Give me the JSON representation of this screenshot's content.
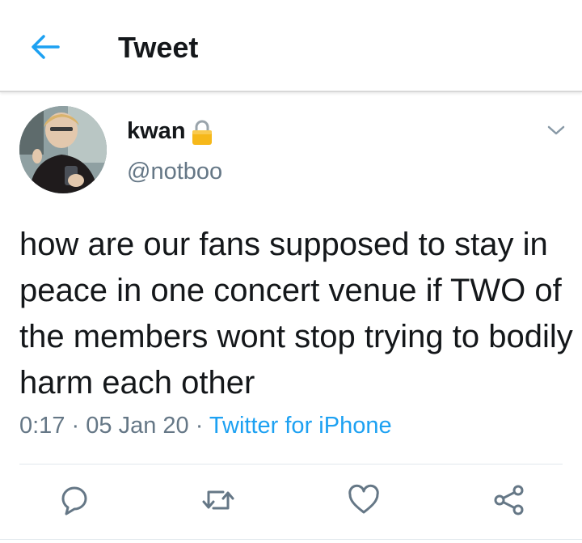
{
  "header": {
    "title": "Tweet",
    "back_icon": "arrow-left-icon",
    "accent_color": "#1da1f2"
  },
  "tweet": {
    "author_name": "kwan",
    "author_handle": "@notboo",
    "protected_icon": "lock-icon",
    "text": "how are our fans supposed to stay in peace in one concert venue if TWO of the members wont stop trying to bodily harm each other",
    "time": "0:17",
    "date": "05 Jan 20",
    "separator": "·",
    "source": "Twitter for iPhone"
  },
  "actions": [
    {
      "icon": "reply-icon"
    },
    {
      "icon": "retweet-icon"
    },
    {
      "icon": "like-icon"
    },
    {
      "icon": "share-icon"
    }
  ],
  "colors": {
    "text": "#14171a",
    "secondary": "#657786",
    "link": "#1da1f2",
    "icon": "#657786"
  }
}
